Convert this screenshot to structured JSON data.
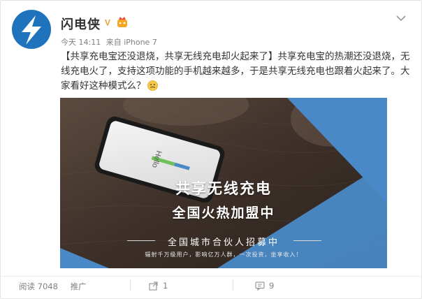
{
  "account": {
    "name": "闪电侠",
    "verified_glyph": "V",
    "avatar_icon": "lightning-bolt-icon",
    "brand_color": "#1f73bd"
  },
  "meta": {
    "time": "今天 14:11",
    "source": "来自 iPhone 7"
  },
  "post": {
    "text": "【共享充电宝还没退烧，共享无线充电却火起来了】共享充电宝的热潮还没退烧，无线充电火了，支持这项功能的手机越来越多，于是共享无线充电也跟着火起来了。大家看好这种模式么？",
    "emoji_icon": "thinking-face-icon"
  },
  "ad": {
    "headline_1": "共享无线充电",
    "headline_2": "全国火热加盟中",
    "recruit": "全国城市合伙人招募中",
    "sub": "辐射千万级用户，影响亿万人群，一次投资，坐享收入！",
    "phone_screen_text": "Hello",
    "accent_color": "#4a89c7"
  },
  "footer": {
    "reads": "阅读 7048",
    "promote": "推广",
    "reposts": "1",
    "comments": "9",
    "repost_icon": "repost-icon",
    "comment_icon": "comment-icon"
  }
}
